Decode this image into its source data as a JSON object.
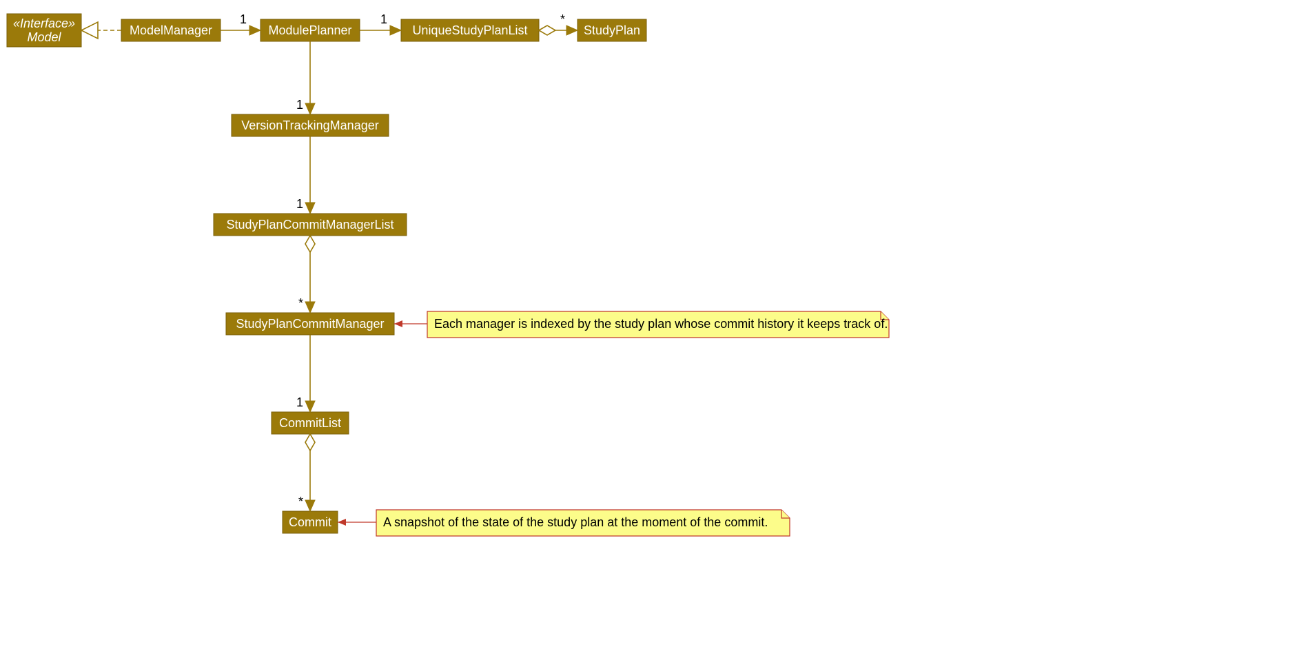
{
  "classes": {
    "model": {
      "stereotype": "«Interface»",
      "name": "Model"
    },
    "modelManager": {
      "name": "ModelManager"
    },
    "modulePlanner": {
      "name": "ModulePlanner"
    },
    "uniqueStudyPlanList": {
      "name": "UniqueStudyPlanList"
    },
    "studyPlan": {
      "name": "StudyPlan"
    },
    "versionTrackingManager": {
      "name": "VersionTrackingManager"
    },
    "studyPlanCommitManagerList": {
      "name": "StudyPlanCommitManagerList"
    },
    "studyPlanCommitManager": {
      "name": "StudyPlanCommitManager"
    },
    "commitList": {
      "name": "CommitList"
    },
    "commit": {
      "name": "Commit"
    }
  },
  "multiplicities": {
    "mm_mp": "1",
    "mp_uspl": "1",
    "uspl_sp": "*",
    "mp_vtm": "1",
    "vtm_spcml": "1",
    "spcml_spcm": "*",
    "spcm_cl": "1",
    "cl_c": "*"
  },
  "notes": {
    "spcmNote": "Each manager is indexed by the study plan whose commit history it keeps track of.",
    "commitNote": "A snapshot of the state of the study plan at the moment of the commit."
  }
}
